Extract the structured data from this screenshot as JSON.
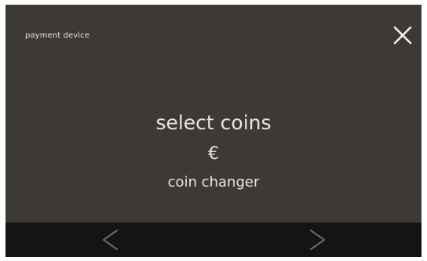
{
  "screen": {
    "title": "payment device",
    "heading": "select coins",
    "currency_symbol": "€",
    "subtext": "coin changer"
  },
  "icons": {
    "close": "close-icon",
    "previous": "chevron-left-icon",
    "next": "chevron-right-icon"
  },
  "colors": {
    "screen_background": "#3d3935",
    "nav_background": "#141414",
    "text": "#e9e6e1",
    "nav_icon": "#6b6661"
  }
}
